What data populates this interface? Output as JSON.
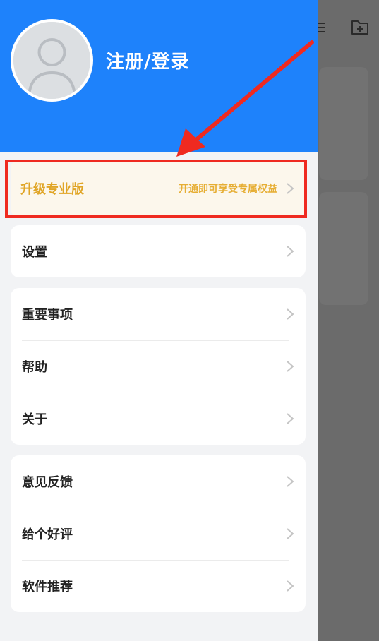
{
  "header": {
    "login_label": "注册/登录"
  },
  "pro": {
    "title": "升级专业版",
    "subtitle": "开通即可享受专属权益"
  },
  "menu_groups": [
    {
      "items": [
        {
          "label": "设置"
        }
      ]
    },
    {
      "items": [
        {
          "label": "重要事项"
        },
        {
          "label": "帮助"
        },
        {
          "label": "关于"
        }
      ]
    },
    {
      "items": [
        {
          "label": "意见反馈"
        },
        {
          "label": "给个好评"
        },
        {
          "label": "软件推荐"
        }
      ]
    }
  ],
  "icons": {
    "avatar": "user-avatar-icon",
    "chevron": "chevron-right-icon",
    "new_folder": "new-folder-icon",
    "list": "list-icon"
  },
  "colors": {
    "header": "#1e82fb",
    "pro_text": "#e0a526",
    "annotation": "#ef2a20",
    "overlay": "#6b6b6b"
  }
}
